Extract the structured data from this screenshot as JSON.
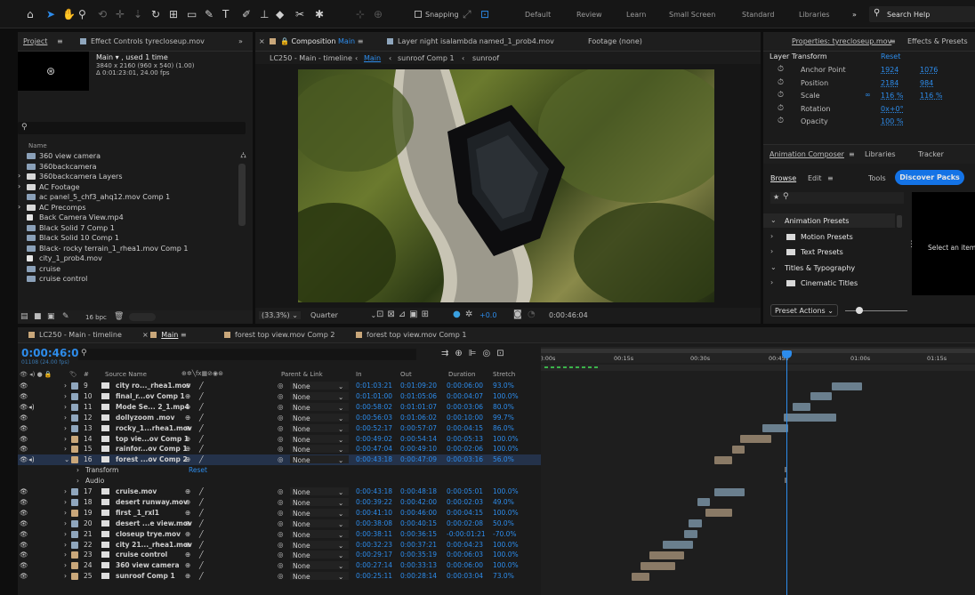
{
  "toolbar": {
    "snapping": "Snapping",
    "workspaces": [
      "Default",
      "Review",
      "Learn",
      "Small Screen",
      "Standard",
      "Libraries"
    ],
    "search": "Search Help",
    "more": "»"
  },
  "project": {
    "tab": "Project",
    "effects_tab": "Effect Controls tyrecloseup.mov",
    "comp_name": "Main ▾ , used 1 time",
    "comp_res": "3840 x 2160  (960 x 540) (1.00)",
    "comp_dur": "Δ 0:01:23:01, 24.00 fps",
    "col_name": "Name",
    "bpc": "16 bpc",
    "items": [
      {
        "name": "360 view camera",
        "kind": "comp"
      },
      {
        "name": "360backcamera",
        "kind": "comp"
      },
      {
        "name": "360backcamera Layers",
        "kind": "folder"
      },
      {
        "name": "AC Footage",
        "kind": "folder"
      },
      {
        "name": "ac panel_5_chf3_ahq12.mov Comp 1",
        "kind": "comp"
      },
      {
        "name": "AC Precomps",
        "kind": "folder"
      },
      {
        "name": "Back Camera View.mp4",
        "kind": "file"
      },
      {
        "name": "Black Solid 7 Comp 1",
        "kind": "comp"
      },
      {
        "name": "Black Solid 10 Comp 1",
        "kind": "comp"
      },
      {
        "name": "Black- rocky terrain_1_rhea1.mov Comp 1",
        "kind": "comp"
      },
      {
        "name": "city_1_prob4.mov",
        "kind": "file"
      },
      {
        "name": "cruise",
        "kind": "comp"
      },
      {
        "name": "cruise control",
        "kind": "comp"
      }
    ]
  },
  "viewer": {
    "comp_tab": "Composition",
    "comp_tab_name": "Main",
    "layer_tab": "Layer night isalambda named_1_prob4.mov",
    "footage_tab": "Footage (none)",
    "crumbs": [
      "LC250 - Main - timeline",
      "Main",
      "sunroof Comp 1",
      "sunroof"
    ],
    "zoom": "(33.3%)",
    "quality": "Quarter",
    "exposure": "+0.0",
    "timecode": "0:00:46:04"
  },
  "props": {
    "tab": "Properties: tyrecloseup.mov",
    "tab2": "Effects & Presets",
    "section": "Layer Transform",
    "reset": "Reset",
    "rows": [
      {
        "label": "Anchor Point",
        "v1": "1924",
        "v2": "1076"
      },
      {
        "label": "Position",
        "v1": "2184",
        "v2": "984"
      },
      {
        "label": "Scale",
        "v1": "116 %",
        "v2": "116 %"
      },
      {
        "label": "Rotation",
        "v1": "0x+0°",
        "v2": ""
      },
      {
        "label": "Opacity",
        "v1": "100 %",
        "v2": ""
      }
    ],
    "composer_tab": "Animation Composer",
    "libraries_tab": "Libraries",
    "tracker_tab": "Tracker",
    "browse": "Browse",
    "edit": "Edit",
    "tools": "Tools",
    "discover": "Discover Packs",
    "tree": [
      {
        "label": "Animation Presets",
        "open": true,
        "indent": 0
      },
      {
        "label": "Motion Presets",
        "open": false,
        "indent": 1
      },
      {
        "label": "Text Presets",
        "open": false,
        "indent": 1
      },
      {
        "label": "Titles & Typography",
        "open": true,
        "indent": 0
      },
      {
        "label": "Cinematic Titles",
        "open": false,
        "indent": 1
      }
    ],
    "hint": "Select an item c above t",
    "preset_actions": "Preset Actions"
  },
  "timeline": {
    "tabs": [
      "LC250 - Main - timeline",
      "Main",
      "forest top view.mov Comp 2",
      "forest top view.mov Comp 1"
    ],
    "timecode": "0:00:46:04",
    "frames": "01108 (24.00 fps)",
    "cols": {
      "num": "#",
      "source": "Source Name",
      "parent": "Parent & Link",
      "in": "In",
      "out": "Out",
      "dur": "Duration",
      "stretch": "Stretch"
    },
    "ruler": [
      "):00s",
      "00:15s",
      "00:30s",
      "00:45s",
      "01:00s",
      "01:15s"
    ],
    "transform": "Transform",
    "transform_reset": "Reset",
    "audio": "Audio",
    "layers": [
      {
        "num": "9",
        "name": "city ro..._rhea1.mov",
        "color": "#8fa6bd",
        "parent": "None",
        "in": "0:01:03:21",
        "out": "0:01:09:20",
        "dur": "0:00:06:00",
        "stretch": "93.0%",
        "bar": [
          0.67,
          0.74
        ],
        "audio": false
      },
      {
        "num": "10",
        "name": "final_r...ov Comp 1",
        "color": "#8fa6bd",
        "parent": "None",
        "in": "0:01:01:00",
        "out": "0:01:05:06",
        "dur": "0:00:04:07",
        "stretch": "100.0%",
        "bar": [
          0.62,
          0.67
        ],
        "audio": false
      },
      {
        "num": "11",
        "name": "Mode Se... 2_1.mp4",
        "color": "#8fa6bd",
        "parent": "None",
        "in": "0:00:58:02",
        "out": "0:01:01:07",
        "dur": "0:00:03:06",
        "stretch": "80.0%",
        "bar": [
          0.58,
          0.62
        ],
        "audio": true
      },
      {
        "num": "12",
        "name": "dollyzoom .mov",
        "color": "#8fa6bd",
        "parent": "None",
        "in": "0:00:56:03",
        "out": "0:01:06:02",
        "dur": "0:00:10:00",
        "stretch": "99.7%",
        "bar": [
          0.56,
          0.68
        ],
        "audio": false
      },
      {
        "num": "13",
        "name": "rocky_1...rhea1.mov",
        "color": "#8fa6bd",
        "parent": "None",
        "in": "0:00:52:17",
        "out": "0:00:57:07",
        "dur": "0:00:04:15",
        "stretch": "86.0%",
        "bar": [
          0.51,
          0.57
        ],
        "audio": false
      },
      {
        "num": "14",
        "name": "top vie...ov Comp 1",
        "color": "#c9a77a",
        "parent": "None",
        "in": "0:00:49:02",
        "out": "0:00:54:14",
        "dur": "0:00:05:13",
        "stretch": "100.0%",
        "bar": [
          0.46,
          0.53
        ],
        "audio": false
      },
      {
        "num": "15",
        "name": "rainfor...ov Comp 1",
        "color": "#c9a77a",
        "parent": "None",
        "in": "0:00:47:04",
        "out": "0:00:49:10",
        "dur": "0:00:02:06",
        "stretch": "100.0%",
        "bar": [
          0.44,
          0.47
        ],
        "audio": false
      },
      {
        "num": "16",
        "name": "forest ...ov Comp 2",
        "color": "#c9a77a",
        "parent": "None",
        "in": "0:00:43:18",
        "out": "0:00:47:09",
        "dur": "0:00:03:16",
        "stretch": "56.0%",
        "bar": [
          0.4,
          0.44
        ],
        "audio": true
      },
      {
        "num": "17",
        "name": "cruise.mov",
        "color": "#8fa6bd",
        "parent": "None",
        "in": "0:00:43:18",
        "out": "0:00:48:18",
        "dur": "0:00:05:01",
        "stretch": "100.0%",
        "bar": [
          0.4,
          0.47
        ],
        "audio": false
      },
      {
        "num": "18",
        "name": "desert runway.mov",
        "color": "#8fa6bd",
        "parent": "None",
        "in": "0:00:39:22",
        "out": "0:00:42:00",
        "dur": "0:00:02:03",
        "stretch": "49.0%",
        "bar": [
          0.36,
          0.39
        ],
        "audio": false
      },
      {
        "num": "19",
        "name": "first _1_rxl1",
        "color": "#c9a77a",
        "parent": "None",
        "in": "0:00:41:10",
        "out": "0:00:46:00",
        "dur": "0:00:04:15",
        "stretch": "100.0%",
        "bar": [
          0.38,
          0.44
        ],
        "audio": false
      },
      {
        "num": "20",
        "name": "desert ...e view.mov",
        "color": "#8fa6bd",
        "parent": "None",
        "in": "0:00:38:08",
        "out": "0:00:40:15",
        "dur": "0:00:02:08",
        "stretch": "50.0%",
        "bar": [
          0.34,
          0.37
        ],
        "audio": false
      },
      {
        "num": "21",
        "name": "closeup trye.mov",
        "color": "#8fa6bd",
        "parent": "None",
        "in": "0:00:38:11",
        "out": "0:00:36:15",
        "dur": "-0:00:01:21",
        "stretch": "-70.0%",
        "bar": [
          0.33,
          0.36
        ],
        "audio": false
      },
      {
        "num": "22",
        "name": "city 21..._rhea1.mov",
        "color": "#8fa6bd",
        "parent": "None",
        "in": "0:00:32:23",
        "out": "0:00:37:21",
        "dur": "0:00:04:23",
        "stretch": "100.0%",
        "bar": [
          0.28,
          0.35
        ],
        "audio": false
      },
      {
        "num": "23",
        "name": "cruise control",
        "color": "#c9a77a",
        "parent": "None",
        "in": "0:00:29:17",
        "out": "0:00:35:19",
        "dur": "0:00:06:03",
        "stretch": "100.0%",
        "bar": [
          0.25,
          0.33
        ],
        "audio": false
      },
      {
        "num": "24",
        "name": "360 view camera",
        "color": "#c9a77a",
        "parent": "None",
        "in": "0:00:27:14",
        "out": "0:00:33:13",
        "dur": "0:00:06:00",
        "stretch": "100.0%",
        "bar": [
          0.23,
          0.31
        ],
        "audio": false
      },
      {
        "num": "25",
        "name": "sunroof Comp 1",
        "color": "#c9a77a",
        "parent": "None",
        "in": "0:00:25:11",
        "out": "0:00:28:14",
        "dur": "0:00:03:04",
        "stretch": "73.0%",
        "bar": [
          0.21,
          0.25
        ],
        "audio": false
      }
    ],
    "playhead": 0.565
  }
}
